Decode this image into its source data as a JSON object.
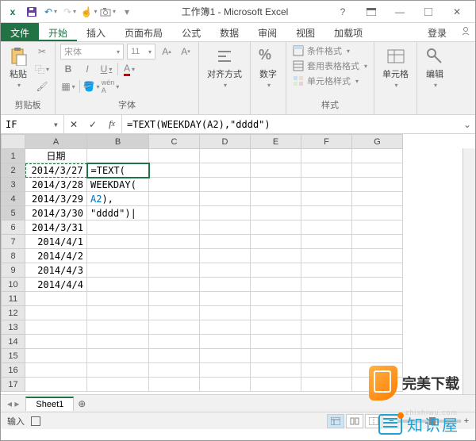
{
  "window": {
    "title": "工作簿1 - Microsoft Excel",
    "help_icon": "?",
    "full_icon": "▢",
    "min_icon": "—",
    "max_icon": "□",
    "close_icon": "✕"
  },
  "qat": {
    "excel_icon": "x",
    "save_icon": "💾",
    "undo_icon": "↶",
    "redo_icon": "↷",
    "touch_icon": "☝",
    "camera_icon": "📷",
    "more_icon": "▾"
  },
  "tabs": {
    "file": "文件",
    "home": "开始",
    "insert": "插入",
    "layout": "页面布局",
    "formulas": "公式",
    "data": "数据",
    "review": "审阅",
    "view": "视图",
    "addins": "加载项",
    "signin": "登录"
  },
  "ribbon": {
    "clipboard": {
      "title": "剪贴板",
      "paste": "粘贴"
    },
    "font": {
      "title": "字体",
      "name": "宋体",
      "size": "11"
    },
    "alignment": {
      "title": "对齐方式"
    },
    "number": {
      "title": "数字",
      "percent": "%"
    },
    "styles": {
      "title": "样式",
      "cond": "条件格式",
      "table": "套用表格格式",
      "cell": "单元格样式"
    },
    "cells": {
      "title": "单元格"
    },
    "editing": {
      "title": "编辑"
    }
  },
  "formula_bar": {
    "name_box": "IF",
    "formula": "=TEXT(WEEKDAY(A2),\"dddd\")"
  },
  "grid": {
    "cols": [
      "A",
      "B",
      "C",
      "D",
      "E",
      "F",
      "G"
    ],
    "header_row": "日期",
    "dates": [
      "2014/3/27",
      "2014/3/28",
      "2014/3/29",
      "2014/3/30",
      "2014/3/31",
      "2014/4/1",
      "2014/4/2",
      "2014/4/3",
      "2014/4/4"
    ],
    "b2_line1": "=TEXT(",
    "b3_line2": "WEEKDAY(",
    "b4_line3": "A2),",
    "b5_line4": "\"dddd\")|",
    "row_count": 17
  },
  "sheet": {
    "tab1": "Sheet1",
    "add": "⊕"
  },
  "status": {
    "mode": "输入",
    "zoom_minus": "−",
    "zoom_plus": "+"
  },
  "watermarks": {
    "wm1": "完美下载",
    "wm2": "知识屋",
    "wm2_sub": "zhishiwu.com"
  }
}
